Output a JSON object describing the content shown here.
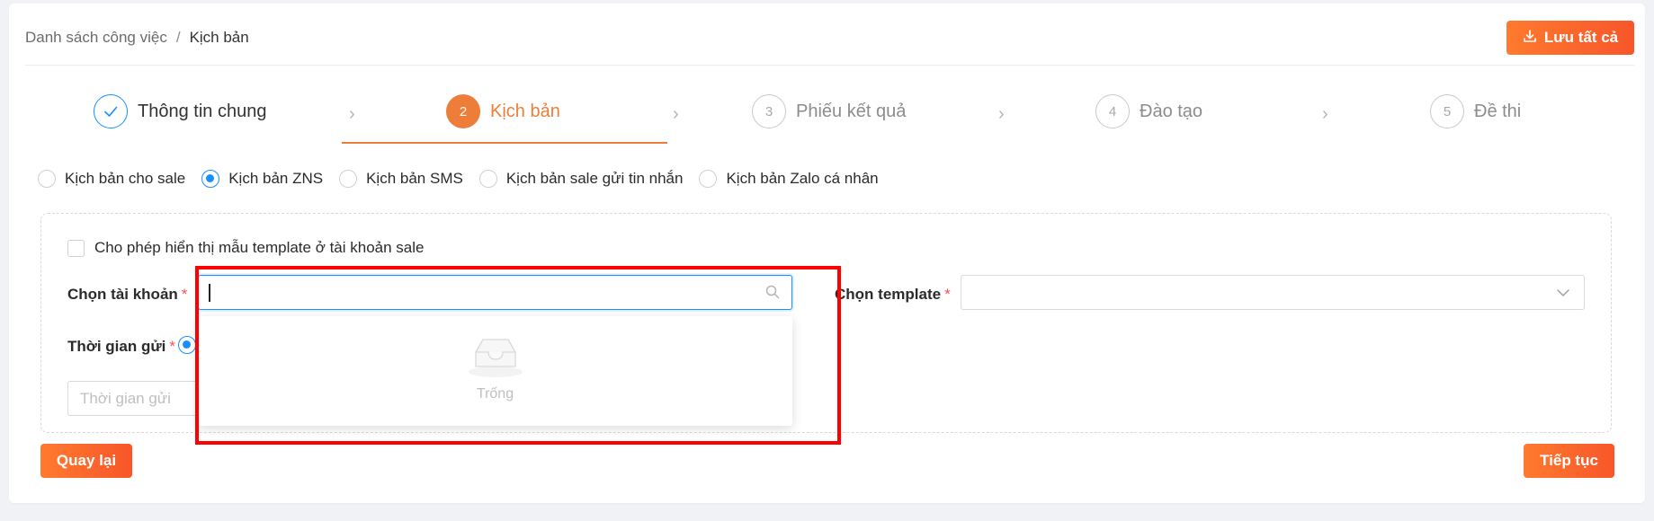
{
  "breadcrumb": {
    "parent": "Danh sách công việc",
    "separator": "/",
    "current": "Kịch bản"
  },
  "header": {
    "save_all_label": "Lưu tất cả",
    "save_icon": "download-icon"
  },
  "steps": [
    {
      "number": "✓",
      "label": "Thông tin chung",
      "status": "done"
    },
    {
      "number": "2",
      "label": "Kịch bản",
      "status": "active"
    },
    {
      "number": "3",
      "label": "Phiếu kết quả",
      "status": "wait"
    },
    {
      "number": "4",
      "label": "Đào tạo",
      "status": "wait"
    },
    {
      "number": "5",
      "label": "Đề thi",
      "status": "wait"
    }
  ],
  "script_types": [
    {
      "label": "Kịch bản cho sale",
      "selected": false
    },
    {
      "label": "Kịch bản ZNS",
      "selected": true
    },
    {
      "label": "Kịch bản SMS",
      "selected": false
    },
    {
      "label": "Kịch bản sale gửi tin nhắn",
      "selected": false
    },
    {
      "label": "Kịch bản Zalo cá nhân",
      "selected": false
    }
  ],
  "form": {
    "allow_template_label": "Cho phép hiển thị mẫu template ở tài khoản sale",
    "allow_template_checked": false,
    "account_label": "Chọn tài khoản",
    "template_label": "Chọn template",
    "required_mark": "*",
    "account_search_value": "",
    "time_label": "Thời gian gửi",
    "time_placeholder": "Thời gian gửi"
  },
  "dropdown": {
    "empty_text": "Trống",
    "empty_icon": "inbox-icon"
  },
  "buttons": {
    "back_label": "Quay lại",
    "next_label": "Tiếp tục"
  },
  "colors": {
    "accent": "#ef7d3a",
    "primary_blue": "#1890ff",
    "required": "#ff4d4f",
    "highlight": "#ff0000"
  }
}
